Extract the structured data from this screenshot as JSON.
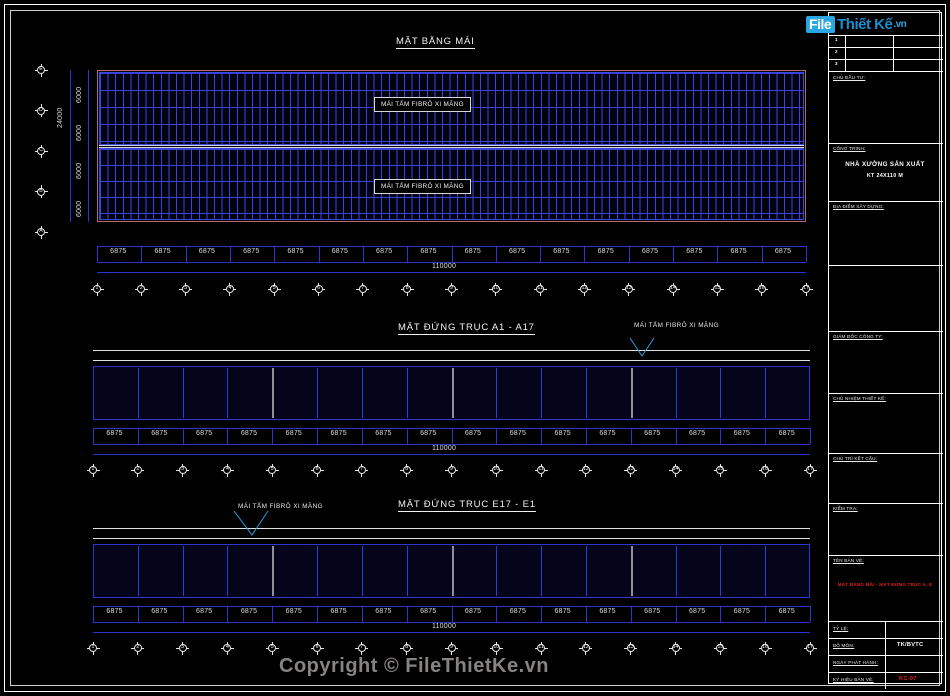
{
  "document": {
    "watermark_logo": {
      "badge": "File",
      "word": "Thiết Kế",
      "tld": ".vn"
    },
    "copyright": "Copyright © FileThietKe.vn"
  },
  "sections": {
    "roof_plan": {
      "title": "MẶT BẰNG MÁI",
      "material_label_top": "MÁI TẤM FIBRÔ XI MĂNG",
      "material_label_bottom": "MÁI TẤM FIBRÔ XI MĂNG",
      "total_width": "110000",
      "total_depth": "24000",
      "bay_width": "6875",
      "bay_depth": "6000",
      "bay_count": 16,
      "depth_bay_count": 4,
      "vertical_axis_labels": [
        "E",
        "D",
        "C",
        "B",
        "A"
      ],
      "horizontal_axis_labels": [
        "1",
        "2",
        "3",
        "4",
        "5",
        "6",
        "7",
        "8",
        "9",
        "10",
        "11",
        "12",
        "13",
        "14",
        "15",
        "16",
        "17"
      ]
    },
    "elevation_a": {
      "title": "MẶT ĐỨNG TRỤC A1 - A17",
      "material_label": "MÁI TẤM FIBRÔ XI MĂNG",
      "total_width": "110000",
      "bay_width": "6875",
      "bay_count": 16,
      "axis_labels": [
        "1",
        "2",
        "3",
        "4",
        "5",
        "6",
        "7",
        "8",
        "9",
        "10",
        "11",
        "12",
        "13",
        "14",
        "15",
        "16",
        "17"
      ]
    },
    "elevation_e": {
      "title": "MẶT ĐỨNG TRỤC E17 - E1",
      "material_label": "MÁI TẤM FIBRÔ XI MĂNG",
      "total_width": "110000",
      "bay_width": "6875",
      "bay_count": 16,
      "axis_labels": [
        "1",
        "2",
        "3",
        "4",
        "5",
        "6",
        "7",
        "8",
        "9",
        "10",
        "11",
        "12",
        "13",
        "14",
        "15",
        "16",
        "17"
      ]
    }
  },
  "title_block": {
    "revision_table": {
      "rows": [
        "1",
        "2",
        "3"
      ]
    },
    "sections": [
      {
        "caption": "CHỦ ĐẦU TƯ:"
      },
      {
        "caption": "CÔNG TRÌNH:"
      },
      {
        "caption": "ĐỊA ĐIỂM XÂY DỰNG:"
      },
      {
        "caption": "GIÁM ĐỐC CÔNG TY:"
      },
      {
        "caption": "CHỦ NHIỆM THIẾT KẾ:"
      },
      {
        "caption": "CHỦ TRÌ KẾT CẤU:"
      },
      {
        "caption": "KIỂM TRA:"
      },
      {
        "caption": "TÊN BẢN VẼ:"
      }
    ],
    "project_name_line1": "NHÀ XƯỞNG SẢN XUẤT",
    "project_name_line2": "KT 24X110 M",
    "drawing_name": "MẶT BẰNG MÁI - MẶT ĐỨNG TRỤC A, E",
    "footer_rows": [
      {
        "caption": "TỶ LỆ:",
        "value": ""
      },
      {
        "caption": "BỘ MÔN:",
        "value": "TK/BVTC"
      },
      {
        "caption": "NGÀY PHÁT HÀNH:",
        "value": ""
      },
      {
        "caption": "KÝ HIỆU BẢN VẼ:",
        "value": "KC-07"
      }
    ]
  },
  "colors": {
    "background": "#000000",
    "line_blue": "#2b34cf",
    "line_white": "#e8e8e8",
    "accent_red": "#e02020",
    "roof_outline": "#b46a6a",
    "logo_blue": "#2ba6e0"
  }
}
